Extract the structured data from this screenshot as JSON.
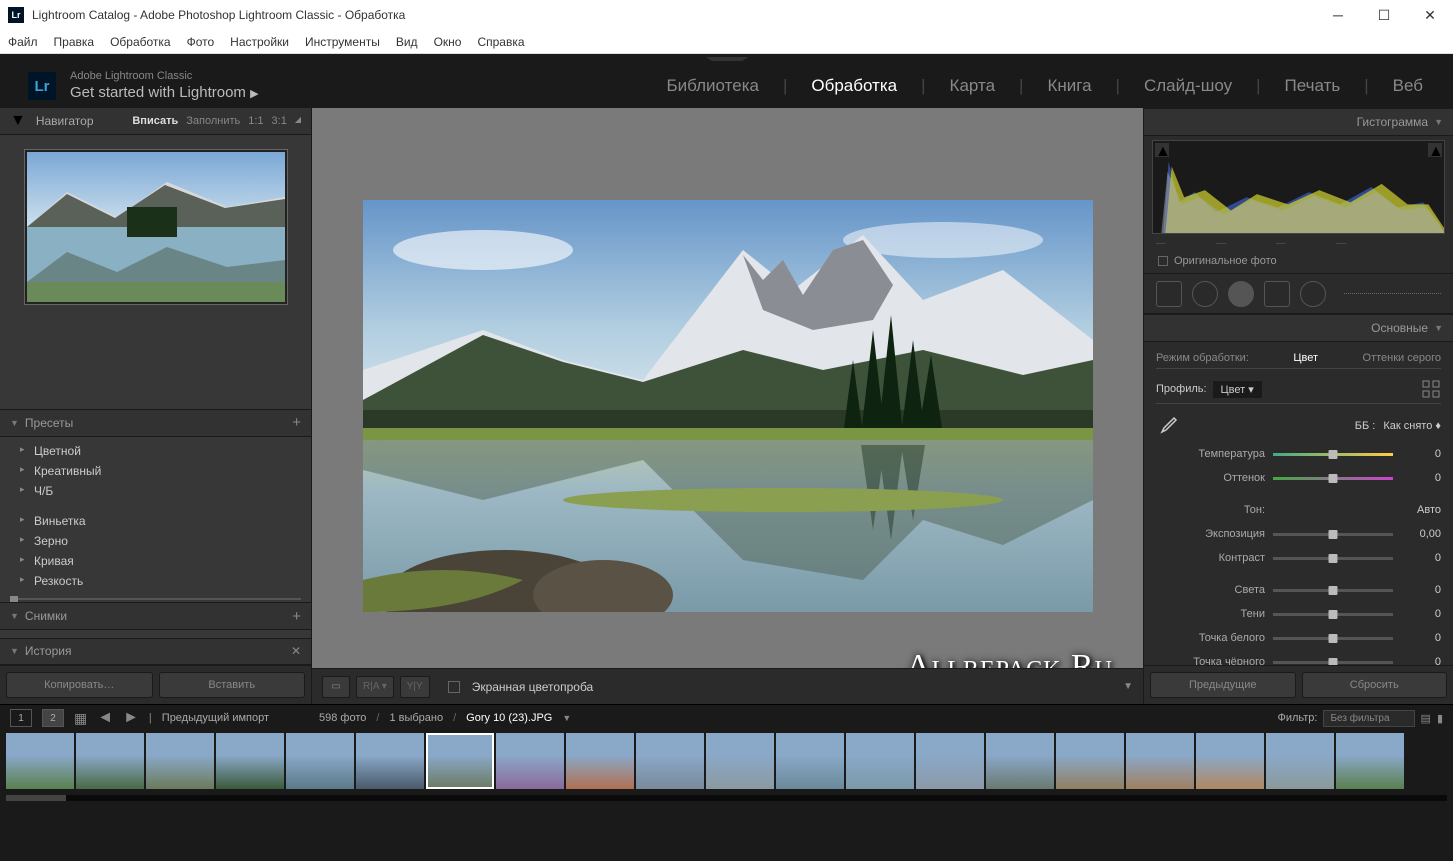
{
  "window": {
    "title": "Lightroom Catalog - Adobe Photoshop Lightroom Classic - Обработка"
  },
  "menubar": [
    "Файл",
    "Правка",
    "Обработка",
    "Фото",
    "Настройки",
    "Инструменты",
    "Вид",
    "Окно",
    "Справка"
  ],
  "brand": {
    "small": "Adobe Lightroom Classic",
    "big": "Get started with Lightroom"
  },
  "modules": [
    "Библиотека",
    "Обработка",
    "Карта",
    "Книга",
    "Слайд-шоу",
    "Печать",
    "Веб"
  ],
  "modules_active": 1,
  "navigator": {
    "title": "Навигатор",
    "zoom": [
      "Вписать",
      "Заполнить",
      "1:1",
      "3:1"
    ],
    "zoom_active": 0
  },
  "presets": {
    "title": "Пресеты",
    "items": [
      "Цветной",
      "Креативный",
      "Ч/Б"
    ],
    "items2": [
      "Виньетка",
      "Зерно",
      "Кривая",
      "Резкость"
    ]
  },
  "snapshots": {
    "title": "Снимки"
  },
  "history": {
    "title": "История"
  },
  "copy_btn": "Копировать…",
  "paste_btn": "Вставить",
  "softproof": "Экранная цветопроба",
  "histogram": {
    "title": "Гистограмма",
    "original": "Оригинальное фото"
  },
  "basic": {
    "title": "Основные",
    "treatment_label": "Режим обработки:",
    "treatment_color": "Цвет",
    "treatment_bw": "Оттенки серого",
    "profile": "Профиль:",
    "profile_val": "Цвет",
    "wb": "ББ :",
    "wb_val": "Как снято",
    "temp": "Температура",
    "temp_val": "0",
    "tint": "Оттенок",
    "tint_val": "0",
    "tone": "Тон:",
    "auto": "Авто",
    "exposure": "Экспозиция",
    "exposure_val": "0,00",
    "contrast": "Контраст",
    "contrast_val": "0",
    "highlights": "Света",
    "highlights_val": "0",
    "shadows": "Тени",
    "shadows_val": "0",
    "whites": "Точка белого",
    "whites_val": "0",
    "blacks": "Точка чёрного",
    "blacks_val": "0"
  },
  "prev_btn": "Предыдущие",
  "reset_btn": "Сбросить",
  "filmstrip": {
    "prev_import": "Предыдущий импорт",
    "count": "598 фото",
    "sel": "1 выбрано",
    "filename": "Gory 10 (23).JPG",
    "filter": "Фильтр:",
    "filter_val": "Без фильтра"
  },
  "watermark": "Allrepack.Ru"
}
